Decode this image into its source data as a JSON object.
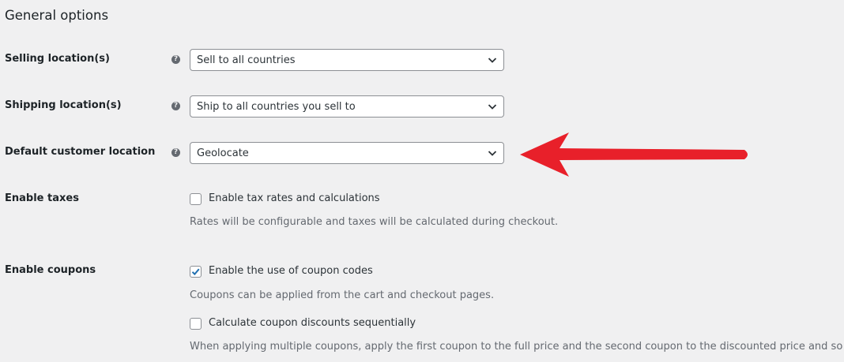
{
  "section": {
    "title": "General options"
  },
  "selling_location": {
    "label": "Selling location(s)",
    "help": "?",
    "value": "Sell to all countries"
  },
  "shipping_location": {
    "label": "Shipping location(s)",
    "help": "?",
    "value": "Ship to all countries you sell to"
  },
  "default_customer_location": {
    "label": "Default customer location",
    "help": "?",
    "value": "Geolocate"
  },
  "enable_taxes": {
    "label": "Enable taxes",
    "checkbox_label": "Enable tax rates and calculations",
    "checked": false,
    "description": "Rates will be configurable and taxes will be calculated during checkout."
  },
  "enable_coupons": {
    "label": "Enable coupons",
    "checkbox_label": "Enable the use of coupon codes",
    "checked": true,
    "description": "Coupons can be applied from the cart and checkout pages.",
    "sequential": {
      "checkbox_label": "Calculate coupon discounts sequentially",
      "checked": false,
      "description": "When applying multiple coupons, apply the first coupon to the full price and the second coupon to the discounted price and so on."
    }
  },
  "annotation": {
    "arrow_color": "#e8202a",
    "icon": "arrow-left-icon"
  },
  "colors": {
    "background": "#f0f0f1",
    "checkmark": "#2271b1"
  }
}
